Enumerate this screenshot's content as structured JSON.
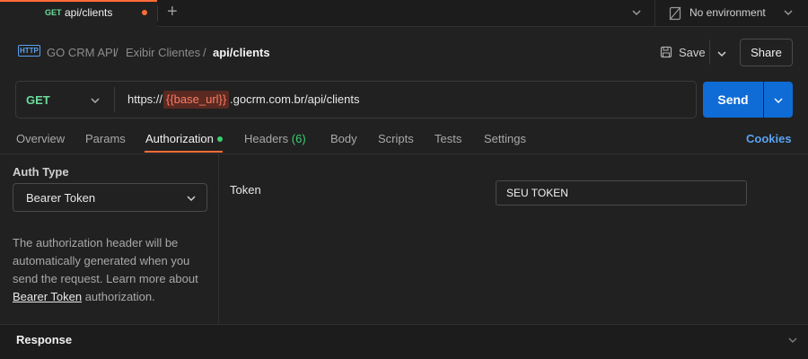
{
  "tab": {
    "method": "GET",
    "title": "api/clients"
  },
  "environment": {
    "label": "No environment"
  },
  "breadcrumb": {
    "icon_text": "HTTP",
    "collection": "GO CRM API",
    "folder": "Exibir Clientes",
    "request": "api/clients",
    "separator": "/"
  },
  "actions": {
    "save_label": "Save",
    "share_label": "Share"
  },
  "request": {
    "method": "GET",
    "url_prefix": "https://",
    "url_variable": "{{base_url}}",
    "url_suffix": ".gocrm.com.br/api/clients",
    "send_label": "Send"
  },
  "request_tabs": {
    "overview": "Overview",
    "params": "Params",
    "authorization": "Authorization",
    "headers": "Headers",
    "headers_count": "(6)",
    "body": "Body",
    "scripts": "Scripts",
    "tests": "Tests",
    "settings": "Settings",
    "cookies": "Cookies"
  },
  "auth": {
    "type_label": "Auth Type",
    "type_value": "Bearer Token",
    "description_before": "The authorization header will be automatically generated when you send the request. Learn more about ",
    "description_link": "Bearer Token",
    "description_after": " authorization.",
    "token_label": "Token",
    "token_value": "SEU TOKEN"
  },
  "response": {
    "label": "Response"
  },
  "colors": {
    "accent": "#ff6c37",
    "send": "#0f6cd6",
    "get": "#6bdd9a",
    "link": "#5aa2f0"
  }
}
